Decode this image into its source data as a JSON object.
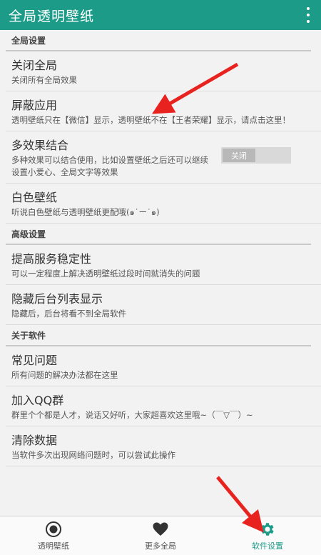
{
  "appbar": {
    "title": "全局透明壁纸",
    "menu_icon": "more-vert-icon"
  },
  "sections": [
    {
      "header": "全局设置"
    },
    {
      "header": "高级设置"
    },
    {
      "header": "关于软件"
    }
  ],
  "items": {
    "close_global": {
      "title": "关闭全局",
      "desc": "关闭所有全局效果"
    },
    "block_apps": {
      "title": "屏蔽应用",
      "desc": "透明壁纸只在【微信】显示，透明壁纸不在【王者荣耀】显示，请点击这里！"
    },
    "multi_effect": {
      "title": "多效果结合",
      "desc": "多种效果可以结合使用，比如设置壁纸之后还可以继续设置小爱心、全局文字等效果",
      "toggle": "关闭"
    },
    "white_wallpaper": {
      "title": "白色壁纸",
      "desc": "听说白色壁纸与透明壁纸更配哦(๑˙ー˙๑)"
    },
    "stability": {
      "title": "提高服务稳定性",
      "desc": "可以一定程度上解决透明壁纸过段时间就消失的问题"
    },
    "hide_recents": {
      "title": "隐藏后台列表显示",
      "desc": "隐藏后，后台将看不到全局软件"
    },
    "faq": {
      "title": "常见问题",
      "desc": "所有问题的解决办法都在这里"
    },
    "qq_group": {
      "title": "加入QQ群",
      "desc": "群里个个都是人才，说话又好听，大家超喜欢这里哦~（￣▽￣）~"
    },
    "clear_data": {
      "title": "清除数据",
      "desc": "当软件多次出现网络问题时，可以尝试此操作"
    }
  },
  "tabs": [
    {
      "label": "透明壁纸",
      "icon": "radio-target-icon"
    },
    {
      "label": "更多全局",
      "icon": "heart-icon"
    },
    {
      "label": "软件设置",
      "icon": "gear-icon",
      "active": true
    }
  ],
  "colors": {
    "primary": "#1c9c88",
    "annotation_arrow": "#e8231f"
  }
}
